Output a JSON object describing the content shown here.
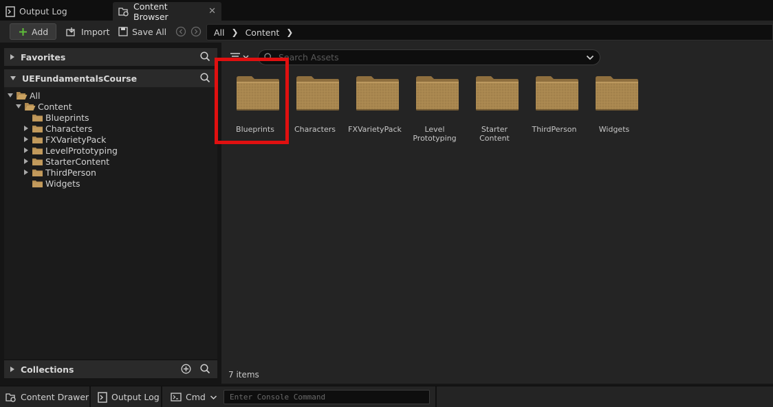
{
  "tabs": [
    {
      "label": "Output Log",
      "icon": "output-log-icon"
    },
    {
      "label": "Content Browser",
      "icon": "content-browser-icon"
    }
  ],
  "toolbar": {
    "add_label": "Add",
    "import_label": "Import",
    "save_all_label": "Save All"
  },
  "breadcrumb": [
    "All",
    "Content"
  ],
  "left_panel": {
    "favorites": "Favorites",
    "project": "UEFundamentalsCourse",
    "collections": "Collections",
    "tree": [
      {
        "label": "All",
        "level": 0
      },
      {
        "label": "Content",
        "level": 1
      },
      {
        "label": "Blueprints",
        "level": 2
      },
      {
        "label": "Characters",
        "level": 2
      },
      {
        "label": "FXVarietyPack",
        "level": 2
      },
      {
        "label": "LevelPrototyping",
        "level": 2
      },
      {
        "label": "StarterContent",
        "level": 2
      },
      {
        "label": "ThirdPerson",
        "level": 2
      },
      {
        "label": "Widgets",
        "level": 2
      }
    ]
  },
  "content": {
    "search_placeholder": "Search Assets",
    "folders": [
      {
        "line1": "Blueprints",
        "line2": ""
      },
      {
        "line1": "Characters",
        "line2": ""
      },
      {
        "line1": "FXVarietyPack",
        "line2": ""
      },
      {
        "line1": "Level",
        "line2": "Prototyping"
      },
      {
        "line1": "Starter",
        "line2": "Content"
      },
      {
        "line1": "ThirdPerson",
        "line2": ""
      },
      {
        "line1": "Widgets",
        "line2": ""
      }
    ],
    "item_count": "7 items"
  },
  "bottom_bar": {
    "content_drawer": "Content Drawer",
    "output_log": "Output Log",
    "cmd": "Cmd",
    "console_placeholder": "Enter Console Command"
  },
  "colors": {
    "highlight": "#e01010",
    "folder": "#a9874f",
    "add_plus": "#5fbf3a"
  }
}
